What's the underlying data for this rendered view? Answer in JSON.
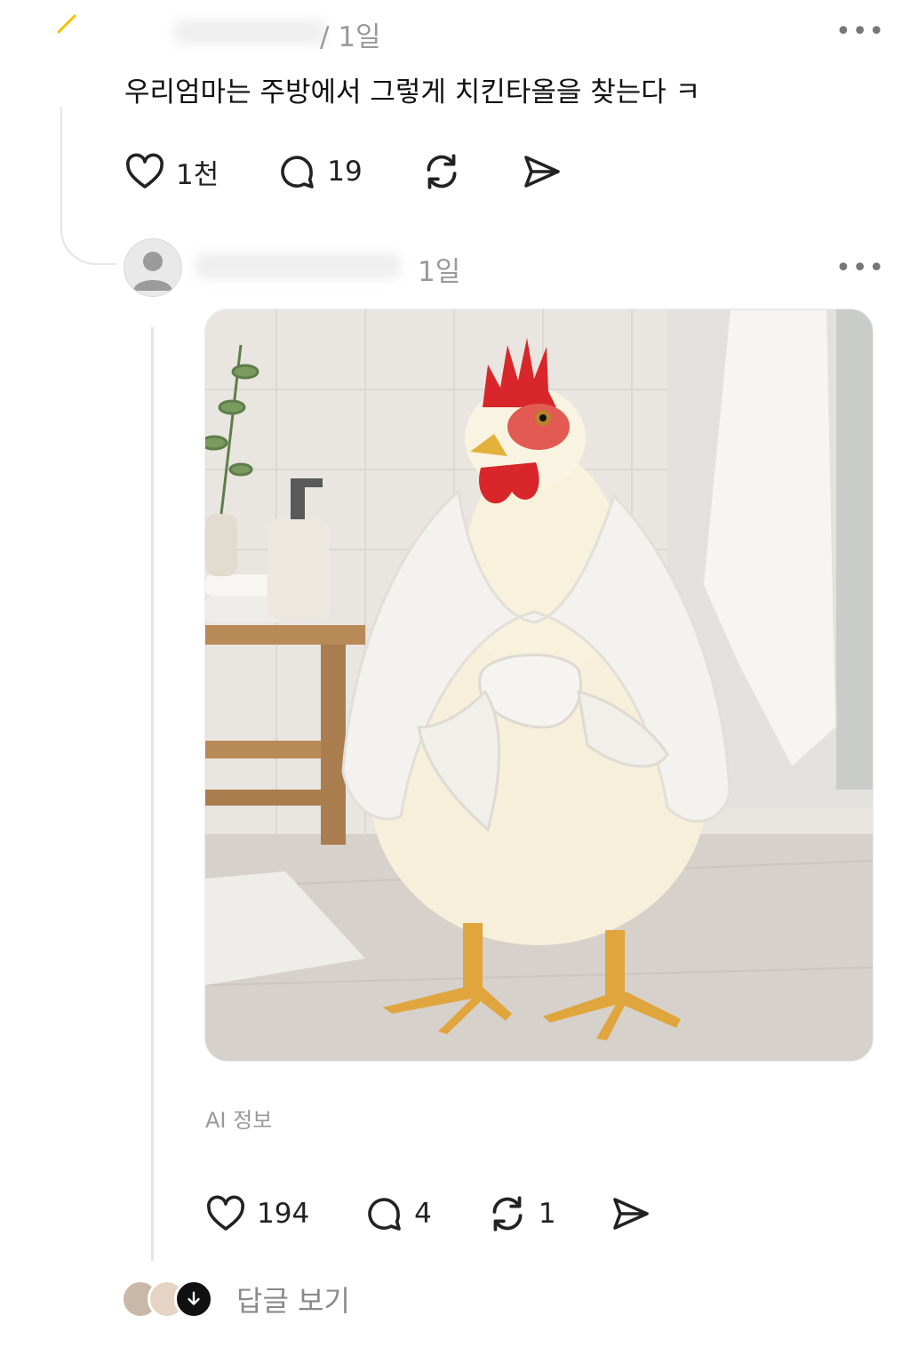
{
  "post1": {
    "time": "1일",
    "more_icon": "more-dots-icon",
    "text": "우리엄마는 주방에서 그렇게 치킨타올을 찾는다 ㅋ",
    "actions": {
      "likes": "1천",
      "comments": "19"
    }
  },
  "post2": {
    "time": "1일",
    "more_icon": "more-dots-icon",
    "ai_info": "AI 정보",
    "actions": {
      "likes": "194",
      "comments": "4",
      "reposts": "1"
    }
  },
  "replies": {
    "label": "답글 보기"
  },
  "colors": {
    "comb": "#d8262b",
    "towel": "#f4f2ee",
    "leg": "#e0a53c",
    "wood": "#b88a57",
    "text_muted": "#9a9a9a"
  }
}
